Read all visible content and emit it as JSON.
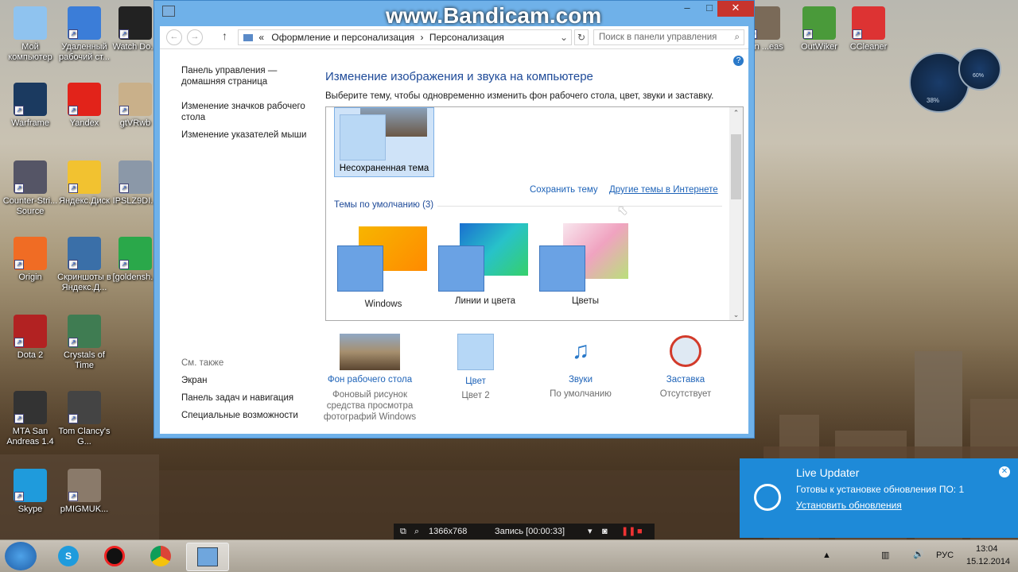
{
  "watermark": "www.Bandicam.com",
  "desktop_icons": [
    {
      "label": "Мой компьютер",
      "icon": "computer-icon"
    },
    {
      "label": "Удаленный рабочий ст...",
      "icon": "remote-desktop-icon"
    },
    {
      "label": "Watch Do...",
      "icon": "watchdogs-icon"
    },
    {
      "label": "Warframe",
      "icon": "warframe-icon"
    },
    {
      "label": "Yandex",
      "icon": "yandex-browser-icon"
    },
    {
      "label": "gtVRwb",
      "icon": "file-icon"
    },
    {
      "label": "Counter-Stri... Source",
      "icon": "cs-source-icon"
    },
    {
      "label": "Яндекс.Диск",
      "icon": "yandex-disk-icon"
    },
    {
      "label": "IPSLZ9DI...",
      "icon": "image-file-icon"
    },
    {
      "label": "Origin",
      "icon": "origin-icon"
    },
    {
      "label": "Скриншоты в Яндекс.Д...",
      "icon": "screenshots-icon"
    },
    {
      "label": "[goldensh...",
      "icon": "torrent-icon"
    },
    {
      "label": "Dota 2",
      "icon": "dota2-icon"
    },
    {
      "label": "Crystals of Time",
      "icon": "crystals-icon"
    },
    {
      "label": "MTA San Andreas 1.4",
      "icon": "mta-icon"
    },
    {
      "label": "Tom Clancy's G...",
      "icon": "ghost-recon-icon"
    },
    {
      "label": "Skype",
      "icon": "skype-icon"
    },
    {
      "label": "pMIGMUK...",
      "icon": "image-file-icon"
    },
    {
      "label": "San ...eas",
      "icon": "gta-icon"
    },
    {
      "label": "OutWiker",
      "icon": "outwiker-icon"
    },
    {
      "label": "CCleaner",
      "icon": "ccleaner-icon"
    }
  ],
  "gadget": {
    "cpu": "38%",
    "ram": "60%"
  },
  "window": {
    "address": {
      "prefix": "«",
      "crumb1": "Оформление и персонализация",
      "sep": "›",
      "crumb2": "Персонализация",
      "search_placeholder": "Поиск в панели управления"
    },
    "left_pane": {
      "home": "Панель управления — домашняя страница",
      "link1": "Изменение значков рабочего стола",
      "link2": "Изменение указателей мыши",
      "see_also": "См. также",
      "also1": "Экран",
      "also2": "Панель задач и навигация",
      "also3": "Специальные возможности"
    },
    "title": "Изменение изображения и звука на компьютере",
    "subtitle": "Выберите тему, чтобы одновременно изменить фон рабочего стола, цвет, звуки и заставку.",
    "unsaved_theme": "Несохраненная тема",
    "save_theme": "Сохранить тему",
    "online_themes": "Другие темы в Интернете",
    "default_themes_header": "Темы по умолчанию (3)",
    "themes": [
      {
        "label": "Windows"
      },
      {
        "label": "Линии и цвета"
      },
      {
        "label": "Цветы"
      }
    ],
    "bottom": [
      {
        "title": "Фон рабочего стола",
        "desc": "Фоновый рисунок средства просмотра фотографий Windows",
        "icon": "wallpaper-icon"
      },
      {
        "title": "Цвет",
        "desc": "Цвет 2",
        "icon": "color-swatch-icon"
      },
      {
        "title": "Звуки",
        "desc": "По умолчанию",
        "icon": "sounds-icon"
      },
      {
        "title": "Заставка",
        "desc": "Отсутствует",
        "icon": "screensaver-icon"
      }
    ]
  },
  "recorder": {
    "resolution": "1366x768",
    "status": "Запись [00:00:33]"
  },
  "toast": {
    "title": "Live Updater",
    "message": "Готовы к установке обновления ПО: 1",
    "action": "Установить обновления"
  },
  "taskbar": {
    "apps": [
      "start-orb-icon",
      "skype-icon",
      "bandicam-icon",
      "chrome-icon",
      "control-panel-icon"
    ],
    "lang": "РУС",
    "time": "13:04",
    "date": "15.12.2014"
  },
  "colors": {
    "accent": "#1e63b8",
    "window_frame": "#6fb1e9",
    "toast": "#1e8ad8",
    "close": "#c7342d"
  }
}
